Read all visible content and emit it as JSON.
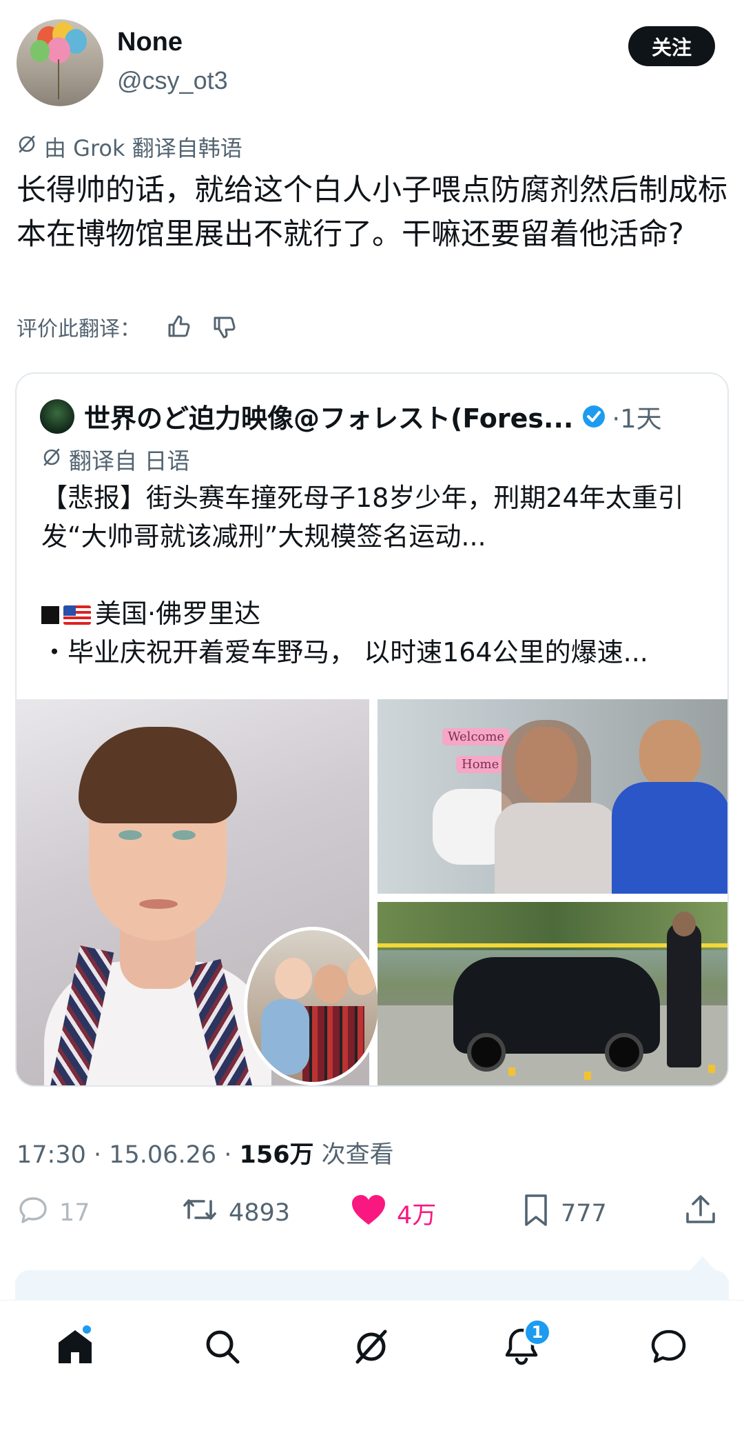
{
  "user": {
    "name": "None",
    "handle": "@csy_ot3",
    "follow_label": "关注"
  },
  "post": {
    "translated_label": "由 Grok 翻译自韩语",
    "text": "长得帅的话，就给这个白人小子喂点防腐剂然后制成标本在博物馆里展出不就行了。干嘛还要留着他活命?",
    "rate_label": "评价此翻译："
  },
  "quote": {
    "author": "世界のど迫力映像@フォレスト(Fores...",
    "time": "·1天",
    "translated_label": "翻译自 日语",
    "line1": "【悲报】街头赛车撞死母子18岁少年，刑期24年太重引发“大帅哥就该减刑”大规模签名运动...",
    "line2": "美国·佛罗里达",
    "line3": "・毕业庆祝开着爱车野马，  以时速164公里的爆速...",
    "images": {
      "sign1": "Welcome",
      "sign2": "Home"
    }
  },
  "meta": {
    "time_date": "17:30 · 15.06.26 · ",
    "views": "156万",
    "views_label": " 次查看"
  },
  "actions": {
    "reply_count": "17",
    "retweet_count": "4893",
    "like_count": "4万",
    "bookmark_count": "777"
  },
  "tabbar": {
    "notif_badge": "1"
  },
  "colors": {
    "accent": "#1d9bf0",
    "like": "#f91880",
    "text": "#0f1419",
    "muted": "#536471"
  }
}
